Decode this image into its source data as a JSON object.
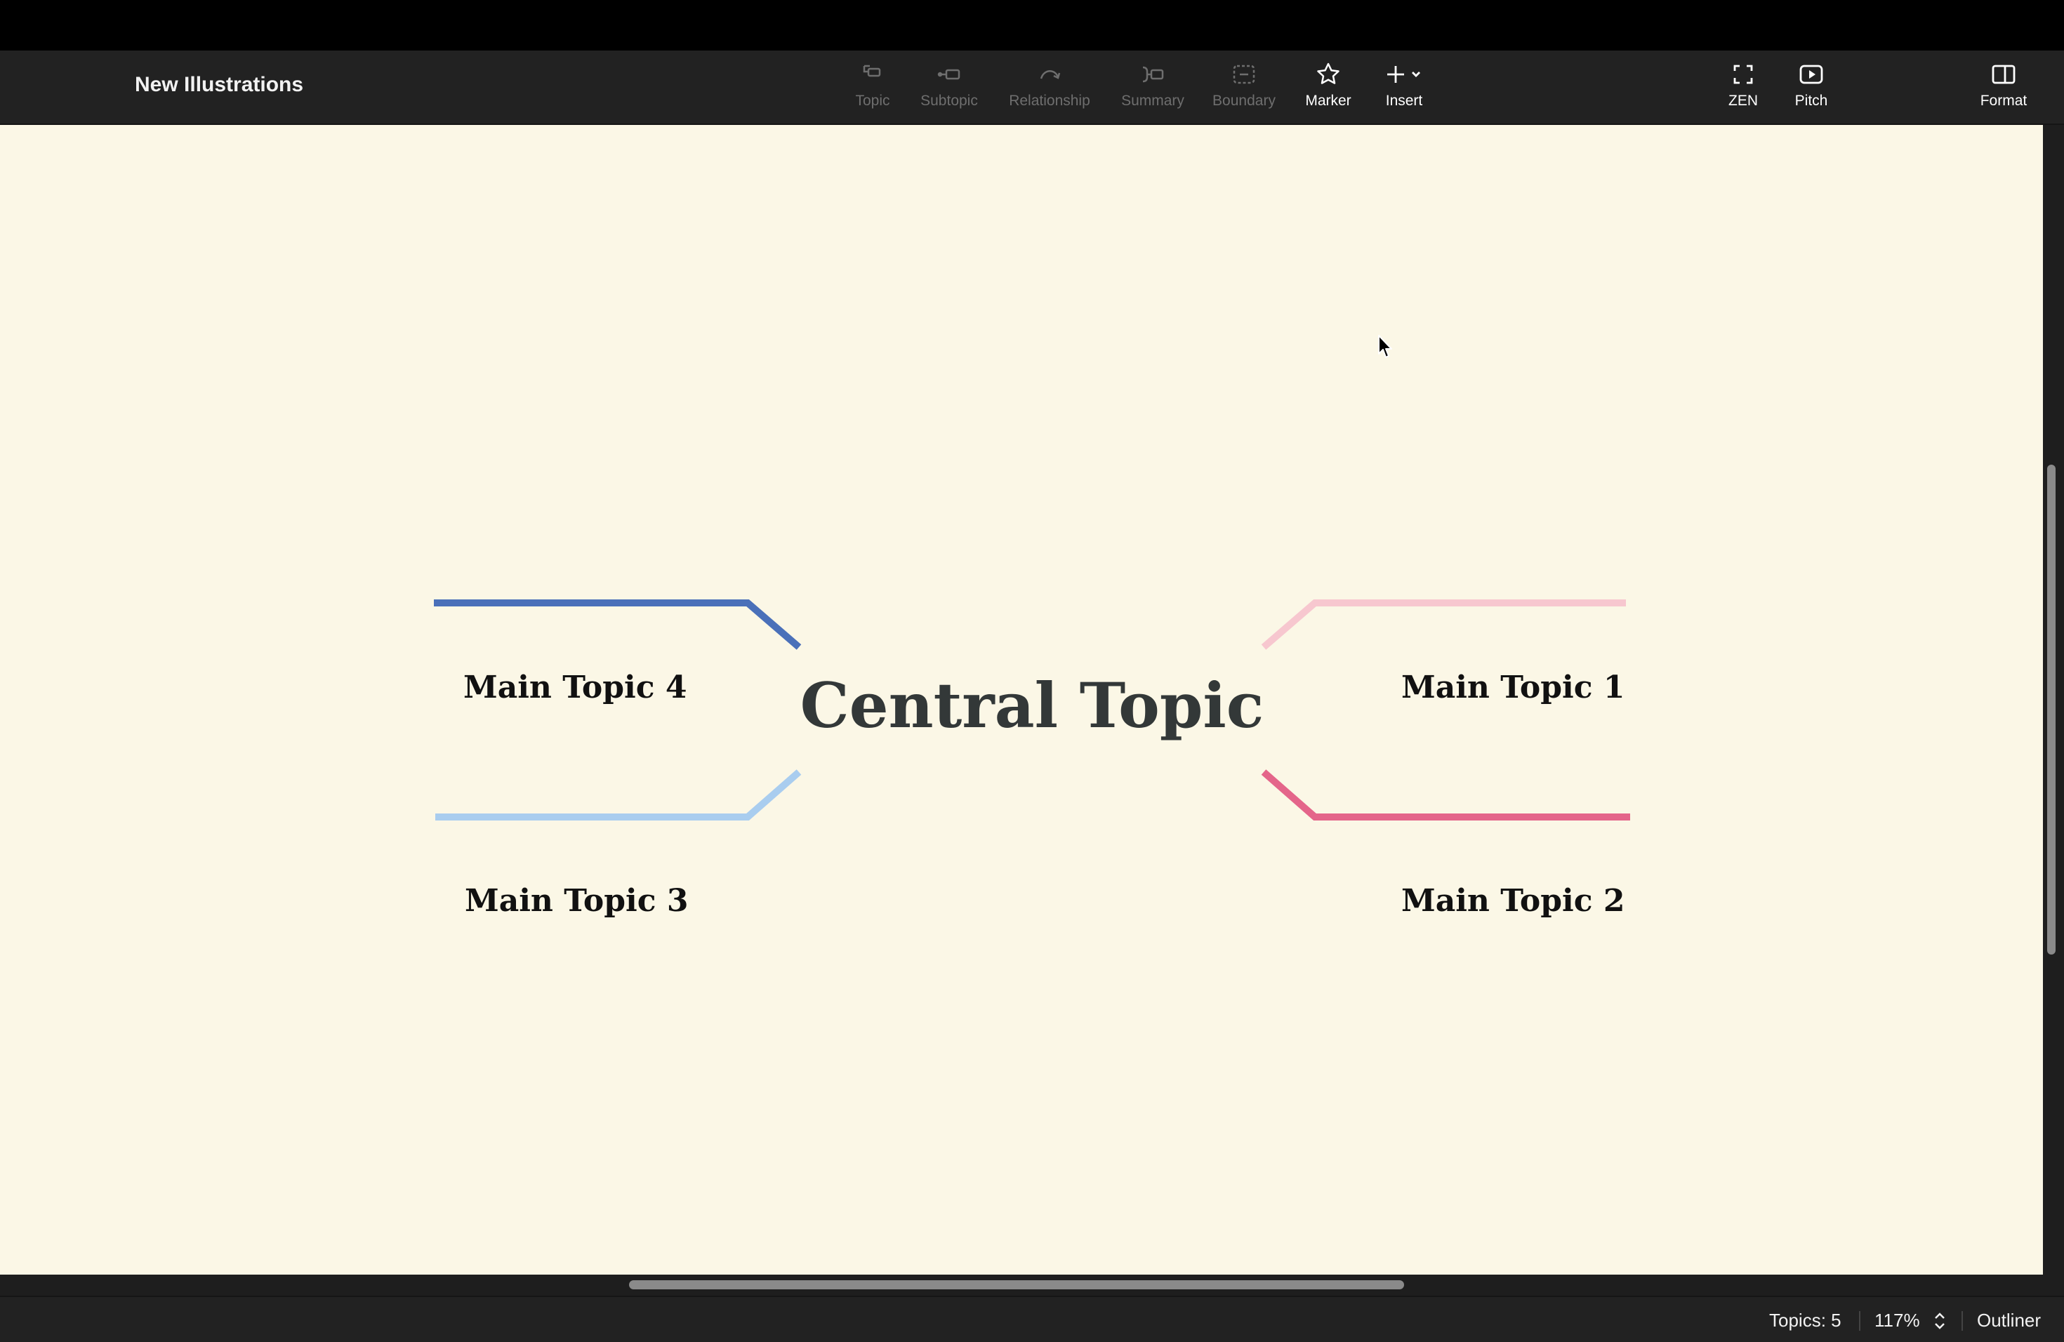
{
  "app": {
    "document_title": "New Illustrations"
  },
  "toolbar": {
    "items": [
      {
        "label": "Topic",
        "icon": "topic-icon",
        "enabled": false
      },
      {
        "label": "Subtopic",
        "icon": "subtopic-icon",
        "enabled": false
      },
      {
        "label": "Relationship",
        "icon": "relationship-icon",
        "enabled": false
      },
      {
        "label": "Summary",
        "icon": "summary-icon",
        "enabled": false
      },
      {
        "label": "Boundary",
        "icon": "boundary-icon",
        "enabled": false
      },
      {
        "label": "Marker",
        "icon": "star-icon",
        "enabled": true
      },
      {
        "label": "Insert",
        "icon": "plus-icon",
        "enabled": true
      }
    ],
    "right_items": [
      {
        "label": "ZEN",
        "icon": "fullscreen-icon"
      },
      {
        "label": "Pitch",
        "icon": "play-icon"
      },
      {
        "label": "Format",
        "icon": "panel-icon"
      }
    ]
  },
  "mindmap": {
    "central_topic": "Central Topic",
    "topics": [
      {
        "label": "Main Topic 1",
        "color": "#f7c7cf"
      },
      {
        "label": "Main Topic 2",
        "color": "#e4658a"
      },
      {
        "label": "Main Topic 3",
        "color": "#a9cdef"
      },
      {
        "label": "Main Topic 4",
        "color": "#4a70b9"
      }
    ],
    "background": "#fbf7e6"
  },
  "status": {
    "topics_count": "Topics: 5",
    "zoom": "117%",
    "outliner": "Outliner"
  }
}
